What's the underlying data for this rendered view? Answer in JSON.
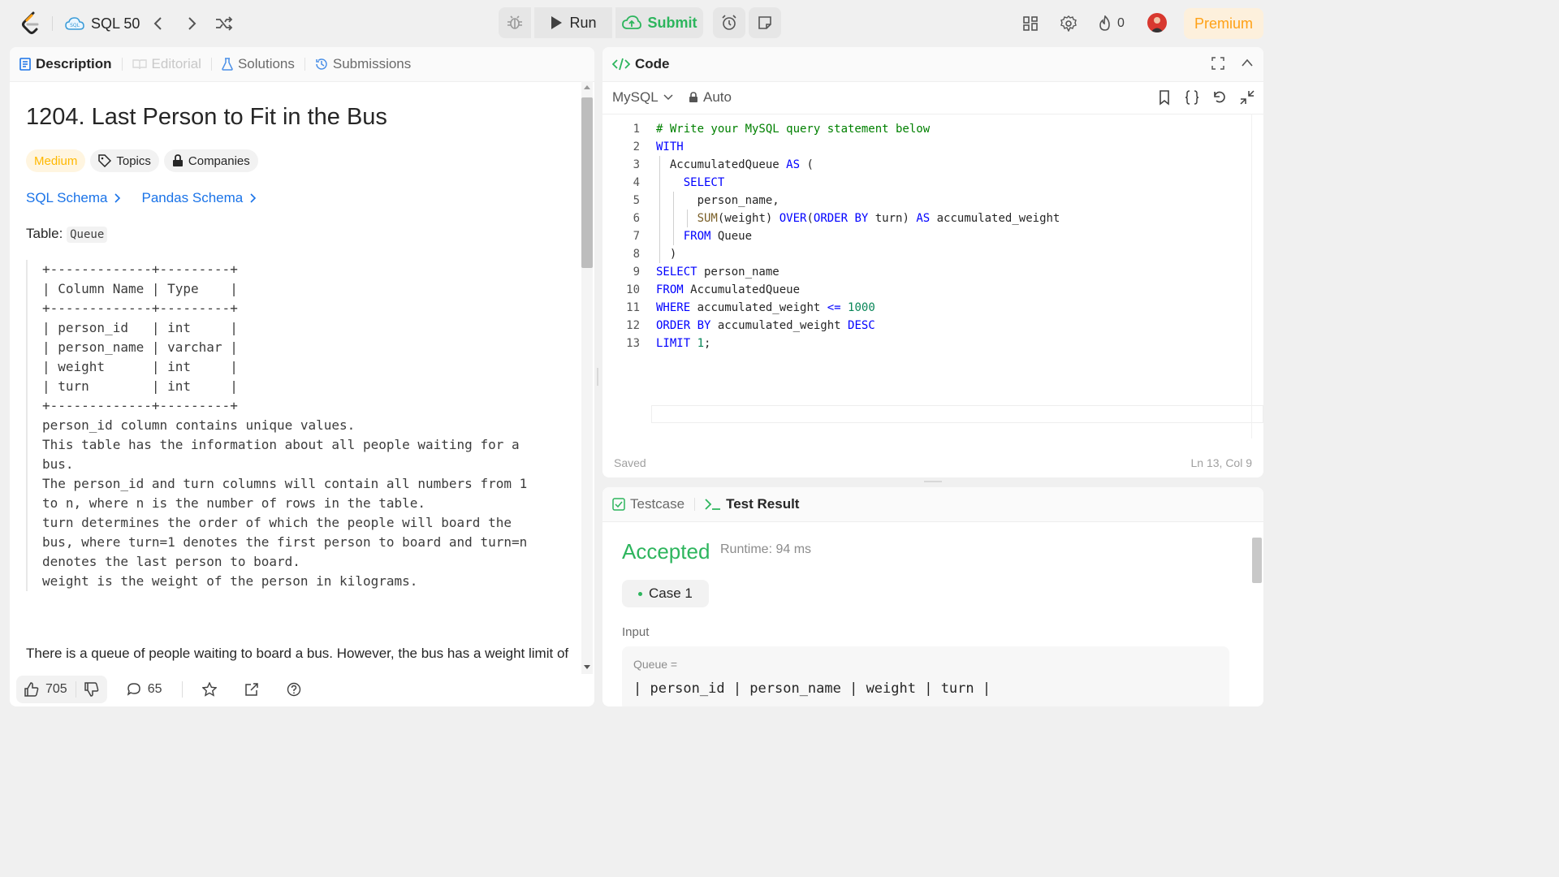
{
  "topbar": {
    "list_title": "SQL 50",
    "run_label": "Run",
    "submit_label": "Submit",
    "streak_count": "0",
    "premium_label": "Premium"
  },
  "left_tabs": [
    {
      "label": "Description"
    },
    {
      "label": "Editorial"
    },
    {
      "label": "Solutions"
    },
    {
      "label": "Submissions"
    }
  ],
  "problem": {
    "title": "1204. Last Person to Fit in the Bus",
    "difficulty": "Medium",
    "topics_label": "Topics",
    "companies_label": "Companies",
    "sql_schema_link": "SQL Schema",
    "pandas_schema_link": "Pandas Schema",
    "table_prefix": "Table:",
    "table_name": "Queue",
    "schema_block": "+-------------+---------+\n| Column Name | Type    |\n+-------------+---------+\n| person_id   | int     |\n| person_name | varchar |\n| weight      | int     |\n| turn        | int     |\n+-------------+---------+\nperson_id column contains unique values.\nThis table has the information about all people waiting for a\nbus.\nThe person_id and turn columns will contain all numbers from 1\nto n, where n is the number of rows in the table.\nturn determines the order of which the people will board the\nbus, where turn=1 denotes the first person to board and turn=n\ndenotes the last person to board.\nweight is the weight of the person in kilograms.",
    "description_start": "There is a queue of people waiting to board a bus. However, the bus has a weight limit of"
  },
  "footer": {
    "likes": "705",
    "comments": "65"
  },
  "code_panel": {
    "title": "Code",
    "language": "MySQL",
    "mode": "Auto",
    "status": "Saved",
    "cursor_position": "Ln 13, Col 9",
    "line_numbers": [
      "1",
      "2",
      "3",
      "4",
      "5",
      "6",
      "7",
      "8",
      "9",
      "10",
      "11",
      "12",
      "13"
    ]
  },
  "test_panel": {
    "tab_testcase": "Testcase",
    "tab_result": "Test Result",
    "verdict": "Accepted",
    "runtime": "Runtime: 94 ms",
    "case_label": "Case 1",
    "input_label": "Input",
    "input_name": "Queue =",
    "input_header": "| person_id | person_name | weight | turn |"
  },
  "colors": {
    "accent_green": "#2db55d",
    "premium_orange": "#ffa116",
    "medium_yellow": "#ffb800",
    "link_blue": "#1a73e8"
  }
}
